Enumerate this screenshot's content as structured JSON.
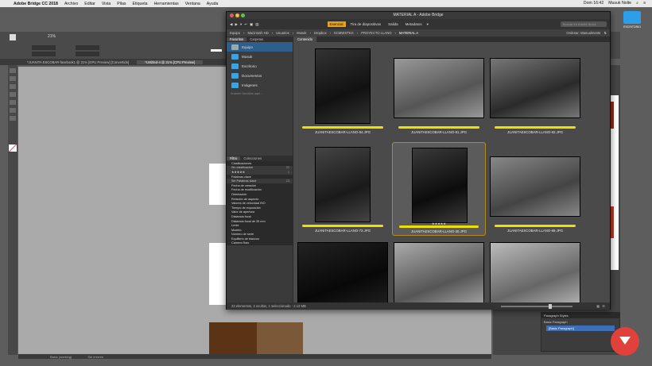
{
  "menubar": {
    "app": "Adobe Bridge CC 2018",
    "items": [
      "Archivo",
      "Editar",
      "Vista",
      "Pilas",
      "Etiqueta",
      "Herramientas",
      "Ventana",
      "Ayuda"
    ],
    "clock": "Dom 16:42",
    "user": "Musuk Nolte"
  },
  "desktop": {
    "folder_label": "ESCRITORIO"
  },
  "indesign": {
    "zoom": "21%",
    "tabs": [
      "*JUANITA ESCOBAR-facebook1 @ 21% [GPU Preview] [Convertido]",
      "*Untitled-4 @ 21% [CPU Preview]"
    ],
    "status_left": "Basic (working)",
    "status_right": "Sin errores",
    "paragraph_styles": {
      "title": "Paragraph Styles",
      "items": [
        "Basic Paragraph",
        "[Basic Paragraph]"
      ]
    }
  },
  "bridge": {
    "title": "MATERIAL A - Adobe Bridge",
    "workspaces": [
      "Esencial",
      "Tira de diapositivas",
      "Salida",
      "Metadatos"
    ],
    "active_workspace": "Esencial",
    "search_placeholder": "Buscar en Adobe Stock",
    "path": [
      "Equipo",
      "Macintosh HD",
      "Usuarios",
      "Musuk",
      "Dropbox",
      "ECMWSTKG",
      "PROYECTO LLANO",
      "MATERIAL A"
    ],
    "sort_label": "Ordenar: Manualmente",
    "left_tabs": [
      "Favoritos",
      "Carpetas"
    ],
    "favorites": [
      "Equipo",
      "Musuk",
      "Escritorio",
      "Documentos",
      "Imágenes"
    ],
    "favorites_hint": "Arrastre favoritos aquí...",
    "filter_tabs": [
      "Filtro",
      "Colecciones"
    ],
    "filters": [
      {
        "label": "Clasificaciones",
        "head": true,
        "count": ""
      },
      {
        "label": "Sin clasificación",
        "head": false,
        "count": "22"
      },
      {
        "label": "★★★★★",
        "head": false,
        "count": "1"
      },
      {
        "label": "Palabras clave",
        "head": true,
        "count": ""
      },
      {
        "label": "Sin Palabras clave",
        "head": false,
        "count": "23"
      },
      {
        "label": "Fecha de creación",
        "head": true,
        "count": ""
      },
      {
        "label": "Fecha de modificación",
        "head": true,
        "count": ""
      },
      {
        "label": "Orientación",
        "head": true,
        "count": ""
      },
      {
        "label": "Relación de aspecto",
        "head": true,
        "count": ""
      },
      {
        "label": "Valores de velocidad ISO",
        "head": true,
        "count": ""
      },
      {
        "label": "Tiempo de exposición",
        "head": true,
        "count": ""
      },
      {
        "label": "Valor de apertura",
        "head": true,
        "count": ""
      },
      {
        "label": "Distancia focal",
        "head": true,
        "count": ""
      },
      {
        "label": "Distancia focal de 35 mm",
        "head": true,
        "count": ""
      },
      {
        "label": "Lente",
        "head": true,
        "count": ""
      },
      {
        "label": "Modelo",
        "head": true,
        "count": ""
      },
      {
        "label": "Número de serie",
        "head": true,
        "count": ""
      },
      {
        "label": "Equilibrio de blancos",
        "head": true,
        "count": ""
      },
      {
        "label": "Camera Raw",
        "head": true,
        "count": ""
      }
    ],
    "content_tab": "Contenido",
    "thumbnails": [
      {
        "name": "JUANITAESCOBAR-LLANO-84.JPG",
        "stars": "",
        "selected": false
      },
      {
        "name": "JUANITAESCOBAR-LLANO-81.JPG",
        "stars": "",
        "selected": false
      },
      {
        "name": "JUANITAESCOBAR-LLANO-82.JPG",
        "stars": "",
        "selected": false
      },
      {
        "name": "JUANITAESCOBAR-LLANO-73.JPG",
        "stars": "",
        "selected": false
      },
      {
        "name": "JUANITAESCOBAR-LLANO-30.JPG",
        "stars": "★★★★★",
        "selected": true
      },
      {
        "name": "JUANITAESCOBAR-LLANO-69.JPG",
        "stars": "",
        "selected": false
      },
      {
        "name": "",
        "stars": "",
        "selected": false
      },
      {
        "name": "",
        "stars": "",
        "selected": false
      },
      {
        "name": "",
        "stars": "",
        "selected": false
      }
    ],
    "footer": "23 elementos, 2 ocultos, 1 seleccionado - 2.13 MB"
  },
  "colors": {
    "accent": "#e8a21a",
    "label_yellow": "#f0e000",
    "folder_blue": "#3ba3e3",
    "logo_red": "#e0413a"
  }
}
